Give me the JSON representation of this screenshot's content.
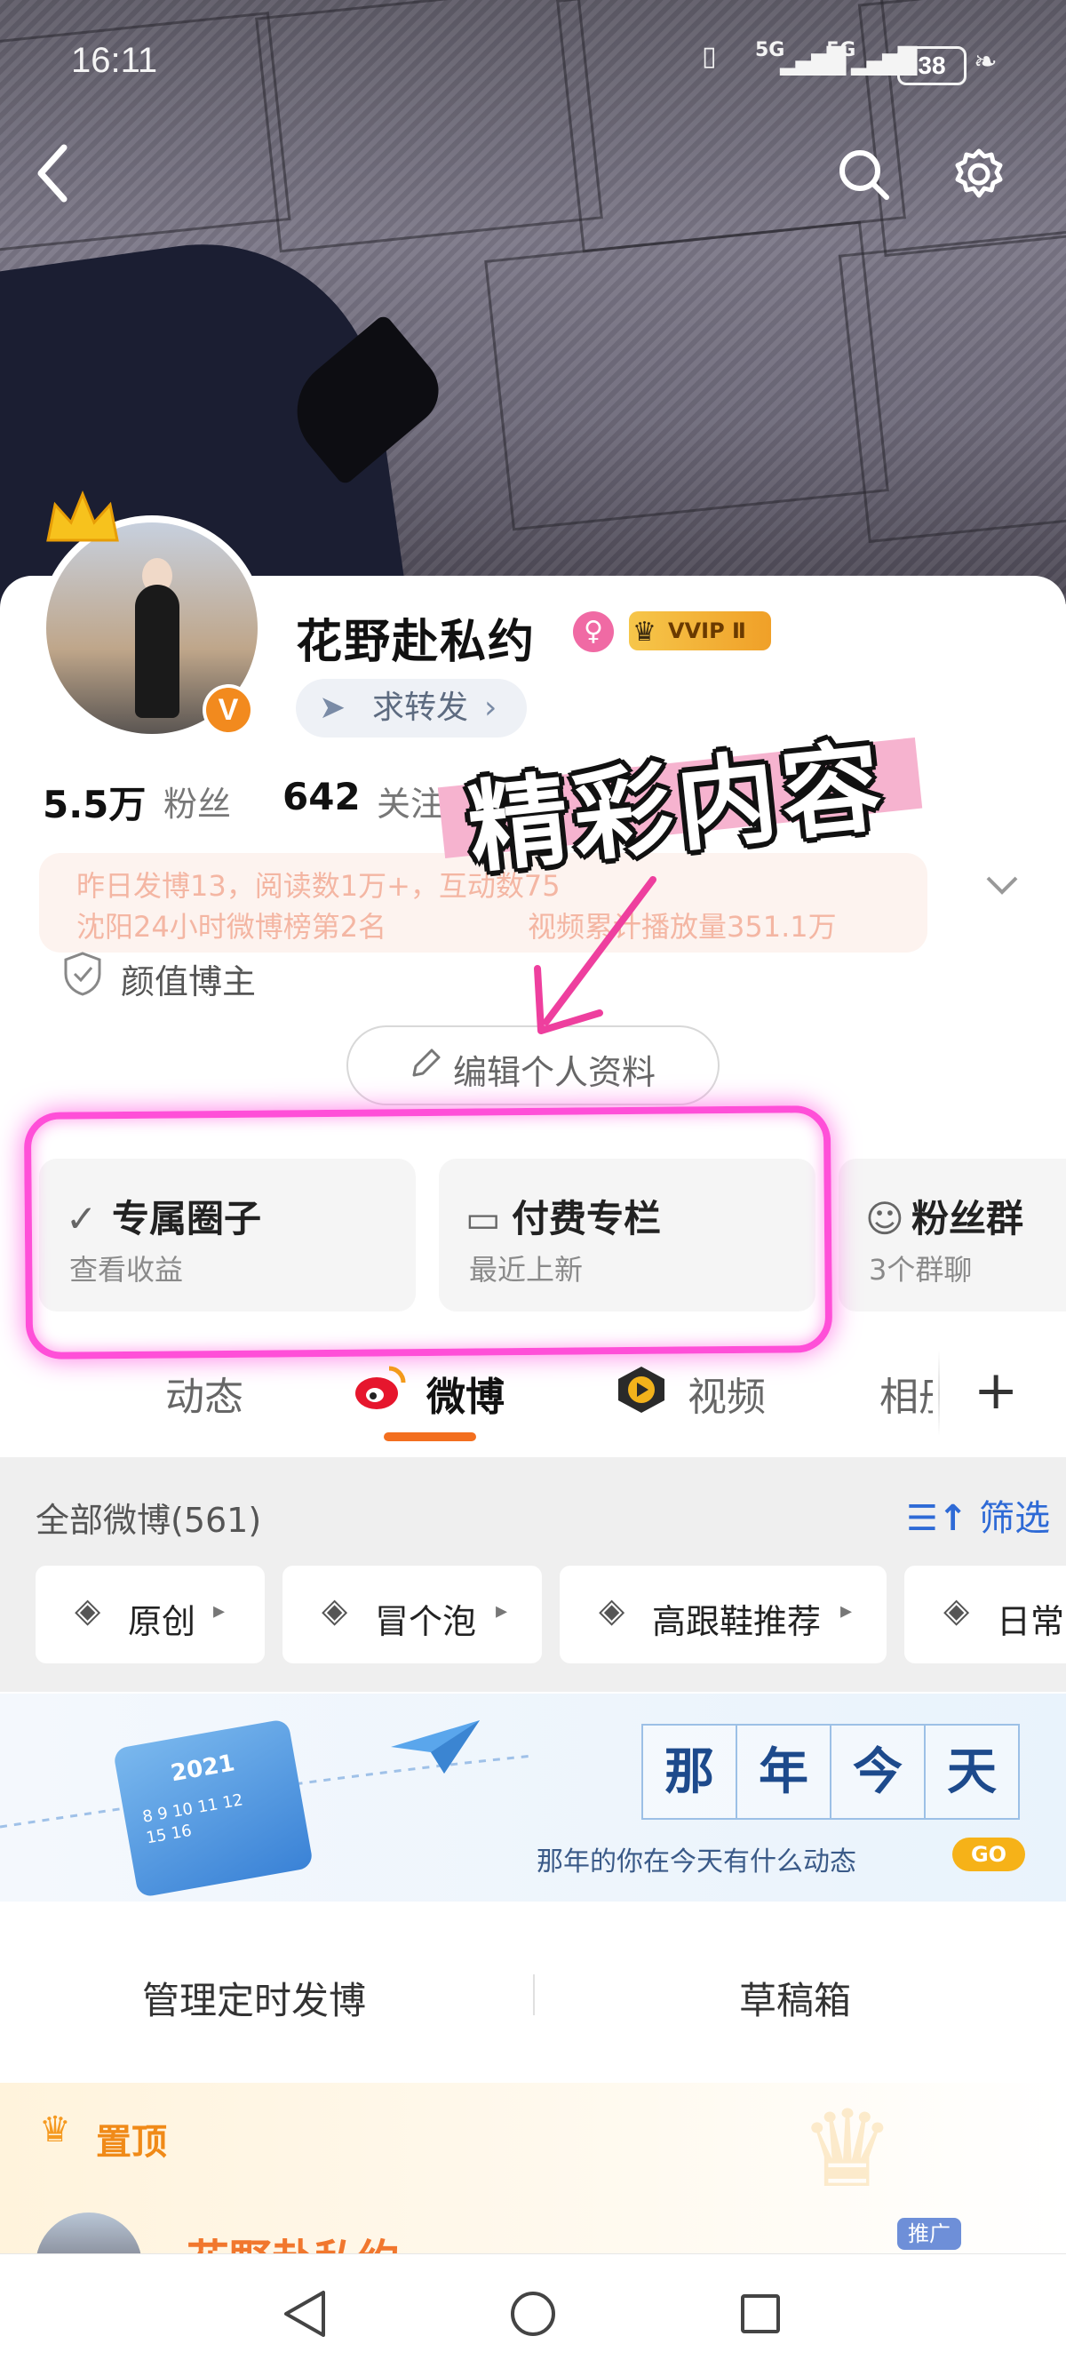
{
  "status_bar": {
    "time": "16:11",
    "battery": "38",
    "signal1": "5G",
    "signal2": "5G"
  },
  "profile": {
    "name": "花野赴私约",
    "vip_badge": "VVIP Ⅱ",
    "verify_mark": "V",
    "repost_label": "求转发",
    "followers_num": "5.5万",
    "followers_label": "粉丝",
    "following_num": "642",
    "following_label": "关注",
    "faded_line1": "昨日发博13，阅读数1万+，互动数75",
    "faded_line2a": "沈阳24小时微博榜第2名",
    "faded_line2b": "视频累计播放量351.1万",
    "tag": "颜值博主",
    "edit_label": "编辑个人资料"
  },
  "promo_text": "精彩内容",
  "features": [
    {
      "title": "专属圈子",
      "sub": "查看收益"
    },
    {
      "title": "付费专栏",
      "sub": "最近上新"
    },
    {
      "title": "粉丝群",
      "sub": "3个群聊"
    }
  ],
  "tabs": [
    "动态",
    "微博",
    "视频",
    "相册"
  ],
  "feed": {
    "count_label": "全部微博(561)",
    "filter_label": "筛选",
    "chips": [
      "原创",
      "冒个泡",
      "高跟鞋推荐",
      "日常"
    ]
  },
  "banner": {
    "chars": [
      "那",
      "年",
      "今",
      "天"
    ],
    "subtitle": "那年的你在今天有什么动态",
    "go": "GO",
    "year": "2021"
  },
  "manage": {
    "left": "管理定时发博",
    "right": "草稿箱"
  },
  "pinned": {
    "label": "置顶",
    "post_name": "花野赴私约",
    "promote": "推广"
  },
  "colors": {
    "accent": "#f36f1f",
    "link": "#2e6ad6",
    "highlight": "#ff4fd8"
  }
}
